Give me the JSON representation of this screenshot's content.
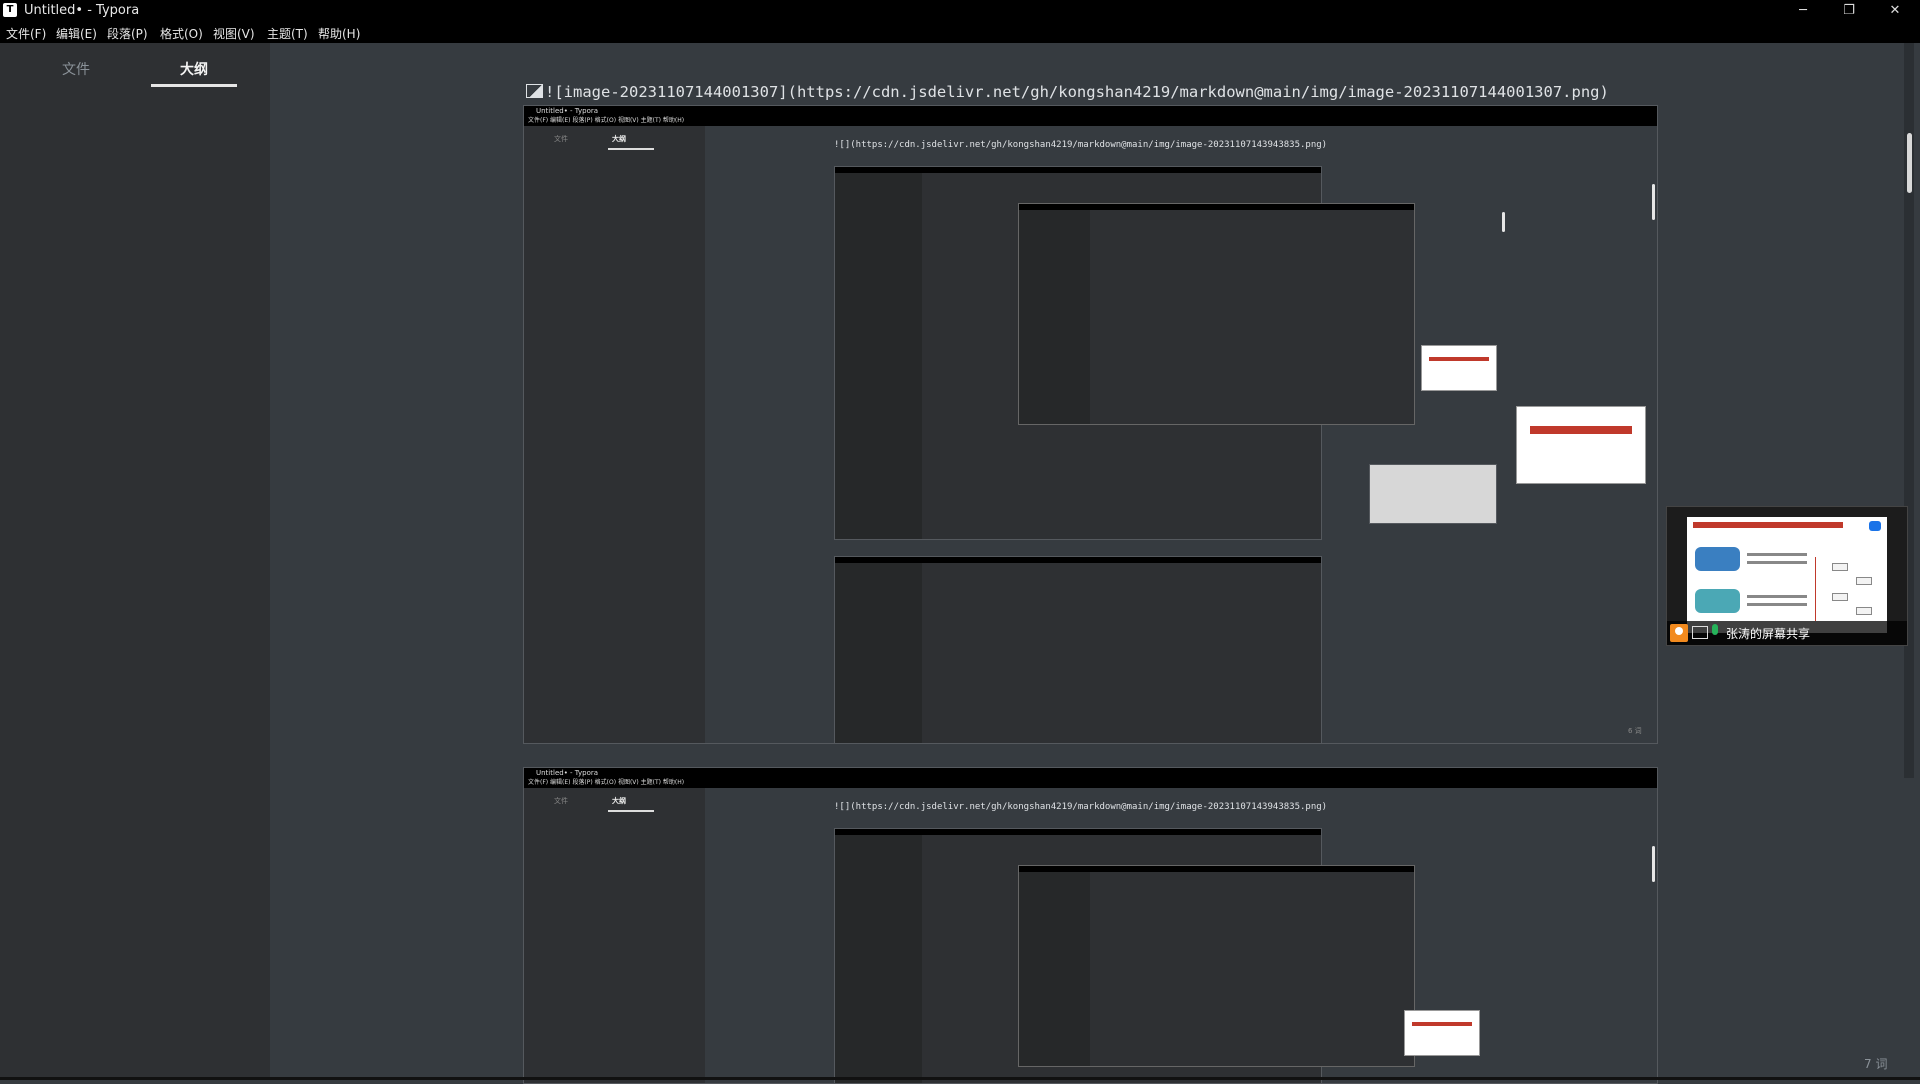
{
  "window": {
    "title": "Untitled• - Typora",
    "icon_letter": "T",
    "minimize_glyph": "─",
    "maximize_glyph": "❐",
    "close_glyph": "✕"
  },
  "menu": [
    "文件(F)",
    "编辑(E)",
    "段落(P)",
    "格式(O)",
    "视图(V)",
    "主题(T)",
    "帮助(H)"
  ],
  "sidebar": {
    "tabs": [
      {
        "label": "文件",
        "active": false
      },
      {
        "label": "大纲",
        "active": true
      }
    ],
    "back_glyph": "‹",
    "source_glyph": "</>"
  },
  "editor": {
    "markdown_line": "![image-20231107144001307](https://cdn.jsdelivr.net/gh/kongshan4219/markdown@main/img/image-20231107144001307.png)",
    "word_count": "7 词"
  },
  "embedded": {
    "title": "Untitled• - Typora",
    "menu": "文件(F)   编辑(E)   段落(P)   格式(O)   视图(V)   主题(T)   帮助(H)",
    "tab_files": "文件",
    "tab_outline": "大纲",
    "markdown_line": "![](https://cdn.jsdelivr.net/gh/kongshan4219/markdown@main/img/image-20231107143943835.png)",
    "word_count": "6 词"
  },
  "screen_share": {
    "label": "张涛的屏幕共享"
  },
  "colors": {
    "editor_bg": "#363b40",
    "sidebar_bg": "#2e3033",
    "titlebar_bg": "#000000",
    "text": "#dfe2e5",
    "share_user": "#f28a1e",
    "mic_active": "#26b35a"
  }
}
